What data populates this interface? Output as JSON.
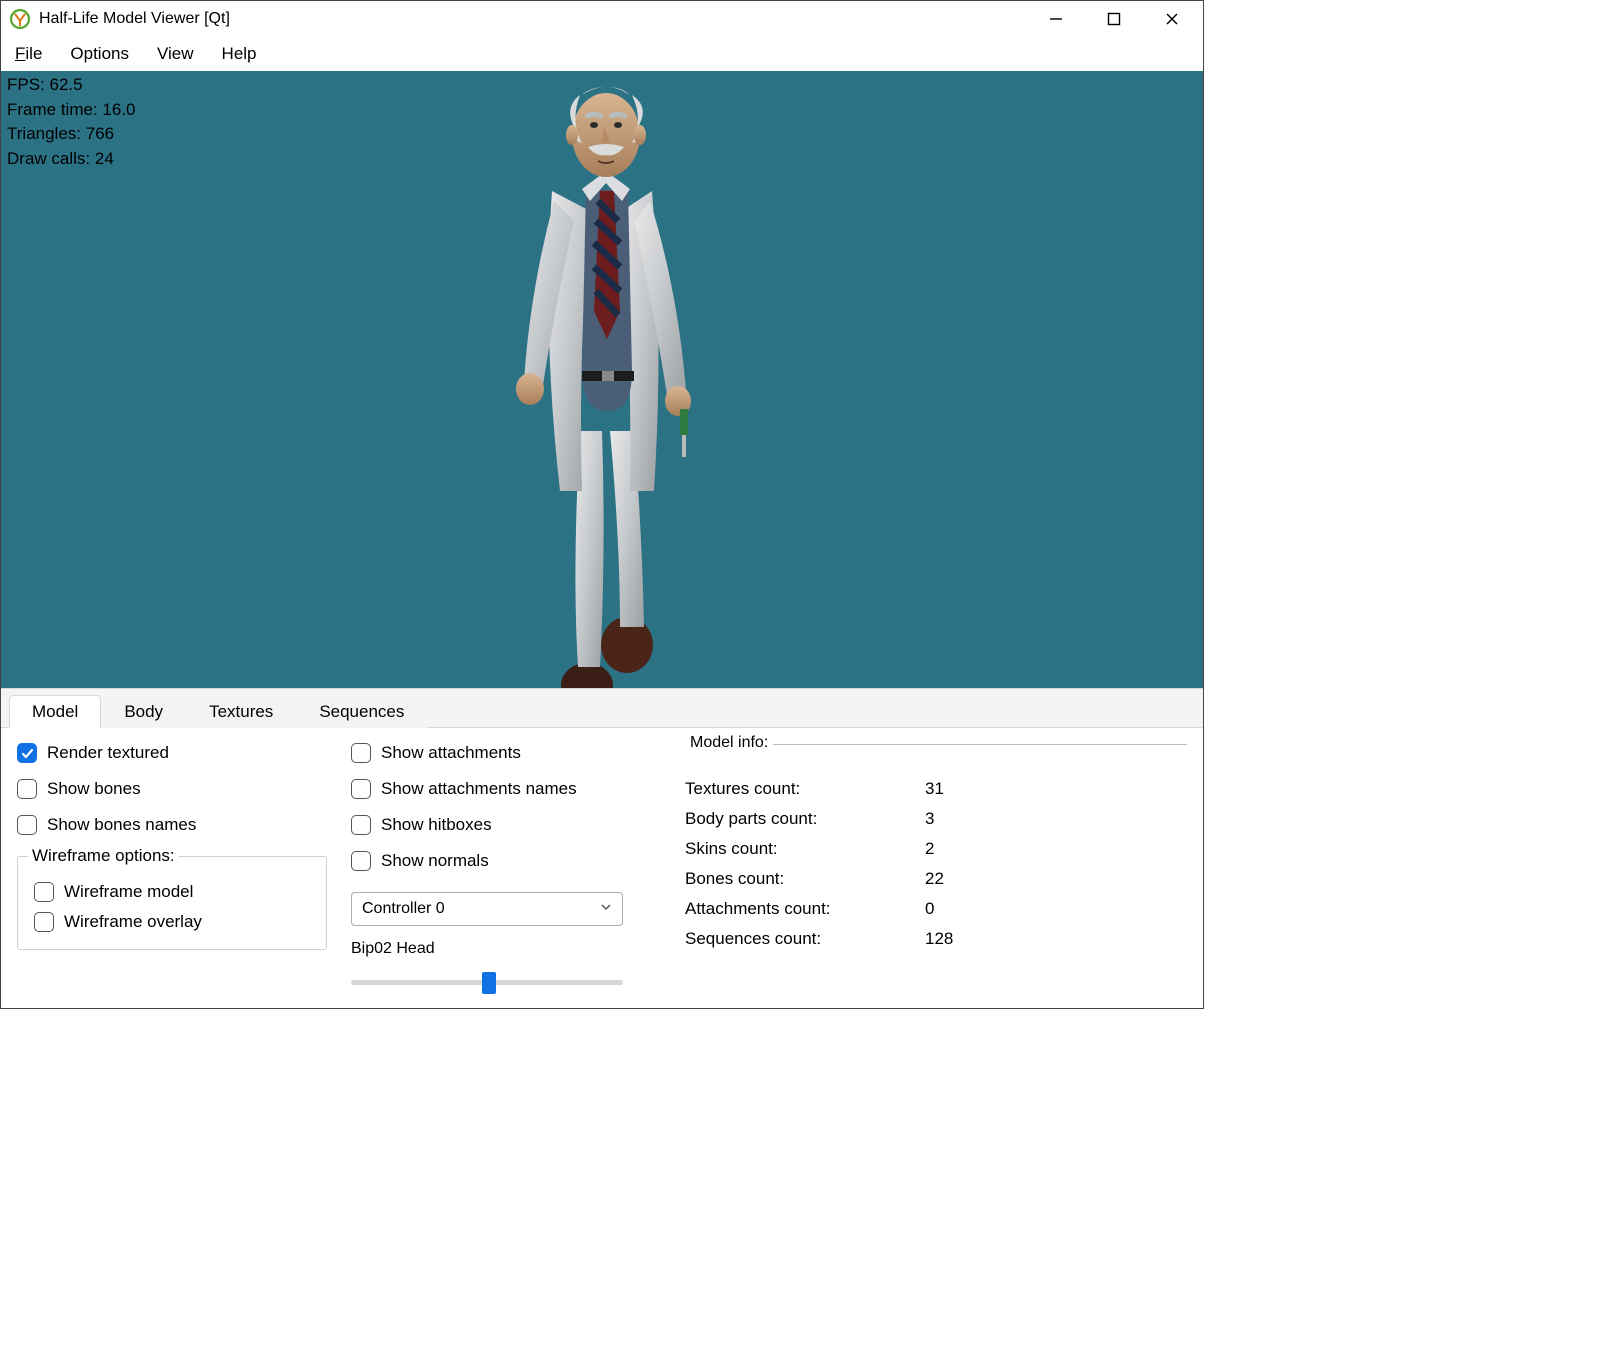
{
  "title": "Half-Life Model Viewer [Qt]",
  "menu": {
    "file": "File",
    "options": "Options",
    "view": "View",
    "help": "Help"
  },
  "stats": {
    "fps_label": "FPS: ",
    "fps_value": "62.5",
    "frame_label": "Frame time: ",
    "frame_value": "16.0",
    "tri_label": "Triangles: ",
    "tri_value": "766",
    "draw_label": "Draw calls: ",
    "draw_value": "24"
  },
  "tabs": {
    "model": "Model",
    "body": "Body",
    "textures": "Textures",
    "sequences": "Sequences"
  },
  "chk": {
    "render_textured": "Render textured",
    "show_bones": "Show bones",
    "show_bones_names": "Show bones names",
    "wire_legend": "Wireframe options:",
    "wire_model": "Wireframe model",
    "wire_overlay": "Wireframe overlay",
    "show_attachments": "Show attachments",
    "show_attachments_names": "Show attachments names",
    "show_hitboxes": "Show hitboxes",
    "show_normals": "Show normals"
  },
  "controller": {
    "select_label": "Controller 0",
    "bone_label": "Bip02 Head"
  },
  "info": {
    "legend": "Model info:",
    "rows": [
      {
        "k": "Textures count:",
        "v": "31"
      },
      {
        "k": "Body parts count:",
        "v": "3"
      },
      {
        "k": "Skins count:",
        "v": "2"
      },
      {
        "k": "Bones count:",
        "v": "22"
      },
      {
        "k": "Attachments count:",
        "v": "0"
      },
      {
        "k": "Sequences count:",
        "v": "128"
      }
    ]
  },
  "colors": {
    "viewport_bg": "#2c7285",
    "accent": "#1071e5"
  }
}
